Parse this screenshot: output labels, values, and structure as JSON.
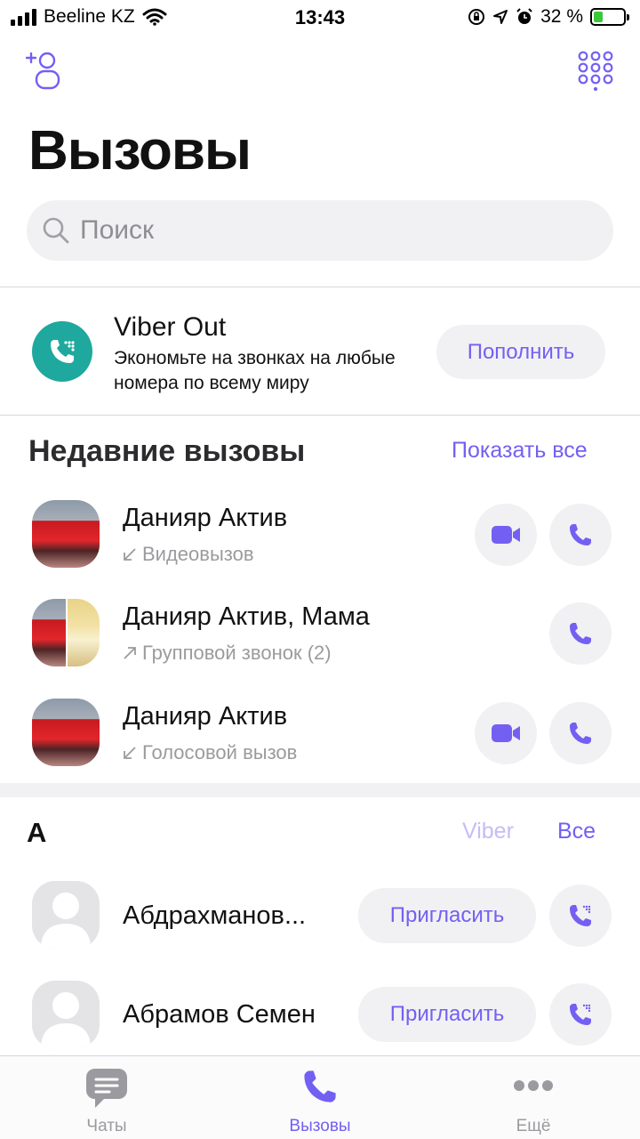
{
  "status_bar": {
    "carrier": "Beeline KZ",
    "time": "13:43",
    "battery": "32 %",
    "battery_level": 0.32
  },
  "header": {
    "title": "Вызовы"
  },
  "search": {
    "placeholder": "Поиск"
  },
  "viber_out": {
    "title": "Viber Out",
    "description": "Экономьте на звонках на любые номера по всему миру",
    "button": "Пополнить"
  },
  "recent": {
    "title": "Недавние вызовы",
    "show_all": "Показать все",
    "items": [
      {
        "name": "Данияр Актив",
        "type": "Видеовызов",
        "direction": "incoming",
        "video": true
      },
      {
        "name": "Данияр Актив, Мама",
        "type": "Групповой звонок (2)",
        "direction": "outgoing",
        "video": false
      },
      {
        "name": "Данияр Актив",
        "type": "Голосовой вызов",
        "direction": "incoming",
        "video": true
      }
    ]
  },
  "contacts": {
    "letter": "A",
    "filter_viber": "Viber",
    "filter_all": "Все",
    "items": [
      {
        "name": "Абдрахманов...",
        "invite": "Пригласить"
      },
      {
        "name": "Абрамов Семен",
        "invite": "Пригласить"
      }
    ]
  },
  "tabs": [
    {
      "label": "Чаты",
      "icon": "chat-bubble-icon",
      "active": false
    },
    {
      "label": "Вызовы",
      "icon": "phone-icon",
      "active": true
    },
    {
      "label": "Ещё",
      "icon": "more-dots-icon",
      "active": false
    }
  ],
  "colors": {
    "accent": "#7360f2",
    "viber_out": "#1fa89e",
    "inactive": "#9b9b9f"
  }
}
